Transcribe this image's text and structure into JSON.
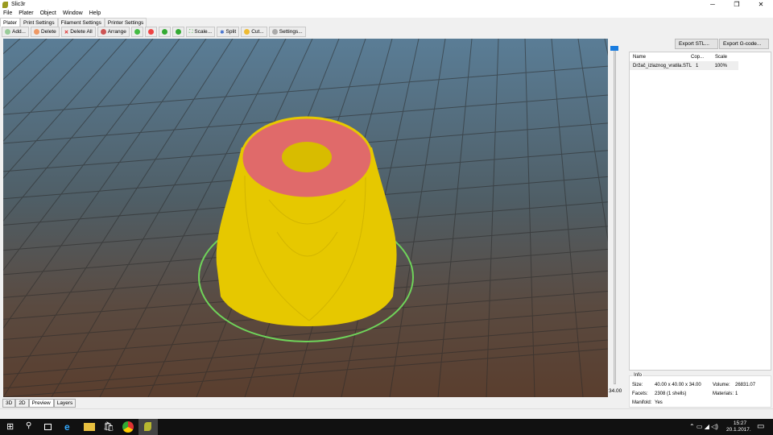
{
  "app": {
    "title": "Slic3r",
    "minimize": "─",
    "maximize": "❐",
    "close": "✕"
  },
  "menu": [
    "File",
    "Plater",
    "Object",
    "Window",
    "Help"
  ],
  "tabs": [
    "Plater",
    "Print Settings",
    "Filament Settings",
    "Printer Settings"
  ],
  "toolbar": {
    "add": "Add...",
    "delete": "Delete",
    "delete_all": "Delete All",
    "arrange": "Arrange",
    "scale": "Scale...",
    "split": "Split",
    "cut": "Cut...",
    "settings": "Settings..."
  },
  "export": {
    "stl": "Export STL...",
    "gcode": "Export G-code..."
  },
  "objects": {
    "headers": [
      "Name",
      "Cop...",
      "Scale"
    ],
    "rows": [
      {
        "name": "Držač_izlaznog_vratila.STL",
        "copies": "1",
        "scale": "100%"
      }
    ]
  },
  "info": {
    "title": "Info",
    "size_label": "Size:",
    "size": "40.00 x 40.00 x 34.00",
    "volume_label": "Volume:",
    "volume": "26831.07",
    "facets_label": "Facets:",
    "facets": "2308 (1 shells)",
    "materials_label": "Materials:",
    "materials": "1",
    "manifold_label": "Manifold:",
    "manifold": "Yes"
  },
  "layer_slider": {
    "value": "34.00",
    "fraction": 1.0
  },
  "view_tabs": [
    "3D",
    "2D",
    "Preview",
    "Layers"
  ],
  "colors": {
    "model": "#e6c800",
    "top": "#e06a6a",
    "bed_circle": "#6fd35a",
    "slider": "#1a7de0"
  },
  "taskbar": {
    "time": "15:27",
    "date": "20.1.2017."
  }
}
